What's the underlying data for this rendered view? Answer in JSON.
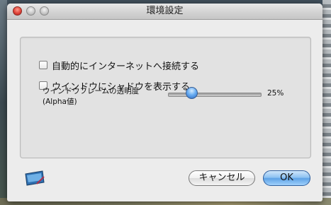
{
  "window": {
    "title": "環境設定"
  },
  "options": {
    "auto_connect_label": "自動的にインターネットへ接続する",
    "auto_connect_checked": false,
    "shadow_label": "ウインドウにシャドウを表示する",
    "shadow_checked": false
  },
  "transparency": {
    "label_line1": "ウインドウフレームの透明度",
    "label_line2": "(Alpha値)",
    "value_text": "25%",
    "value": 0.25
  },
  "buttons": {
    "cancel_label": "キャンセル",
    "ok_label": "OK"
  },
  "icons": {
    "close": "close-icon",
    "minimize": "minimize-icon",
    "zoom": "zoom-icon",
    "app": "app-icon"
  },
  "colors": {
    "accent": "#5ea2e6",
    "close": "#e0443a"
  }
}
